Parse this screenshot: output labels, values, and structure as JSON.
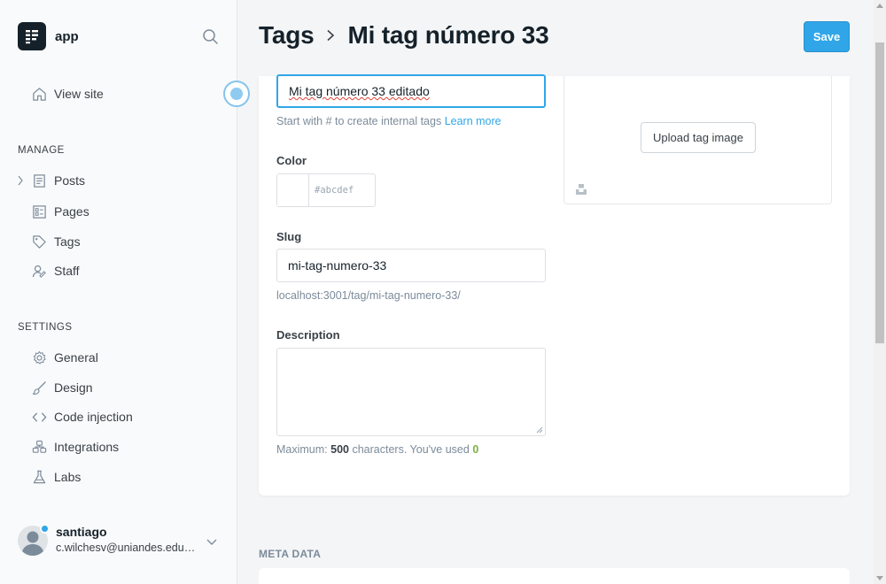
{
  "brand": {
    "name": "app"
  },
  "nav": {
    "view_site": "View site",
    "manage_title": "MANAGE",
    "manage_items": [
      "Posts",
      "Pages",
      "Tags",
      "Staff"
    ],
    "settings_title": "SETTINGS",
    "settings_items": [
      "General",
      "Design",
      "Code injection",
      "Integrations",
      "Labs"
    ]
  },
  "user": {
    "name": "santiago",
    "email": "c.wilchesv@uniandes.edu.co"
  },
  "header": {
    "breadcrumb_parent": "Tags",
    "title": "Mi tag número 33",
    "save_label": "Save"
  },
  "form": {
    "name_value": "Mi tag número 33 editado",
    "name_hint": "Start with # to create internal tags",
    "learn_more": "Learn more",
    "color_label": "Color",
    "color_hash": "#",
    "color_placeholder": "abcdef",
    "slug_label": "Slug",
    "slug_value": "mi-tag-numero-33",
    "slug_url": "localhost:3001/tag/mi-tag-numero-33/",
    "description_label": "Description",
    "description_value": "",
    "max_prefix": "Maximum:",
    "max_count": "500",
    "max_middle": "characters. You've used",
    "used_count": "0",
    "upload_label": "Upload tag image"
  },
  "meta": {
    "section_title": "META DATA"
  },
  "colors": {
    "accent": "#30a6e8",
    "used_count": "#7cb342"
  }
}
